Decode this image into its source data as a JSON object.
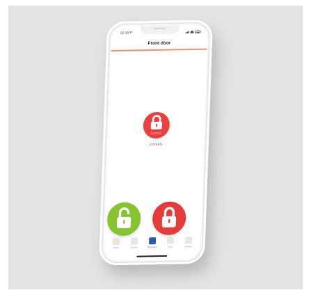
{
  "status_bar": {
    "time": "12:18 P"
  },
  "header": {
    "title": "Front door"
  },
  "lock_status": {
    "status_label": "STATUS",
    "state_text": "LOCKED"
  },
  "actions": {
    "unlock_icon": "unlocked-padlock-icon",
    "lock_icon": "locked-padlock-icon"
  },
  "colors": {
    "accent": "#f08f6e",
    "lock_red": "#e63b3b",
    "unlock_green": "#86c232",
    "tab_active": "#2a5db0"
  },
  "tabs": [
    {
      "label": "Home",
      "icon": "home-icon",
      "active": false
    },
    {
      "label": "Events",
      "icon": "events-icon",
      "active": false
    },
    {
      "label": "Front door",
      "icon": "lock-icon",
      "active": true
    },
    {
      "label": "Keys",
      "icon": "keys-icon",
      "active": false
    },
    {
      "label": "Settings",
      "icon": "settings-icon",
      "active": false
    }
  ]
}
